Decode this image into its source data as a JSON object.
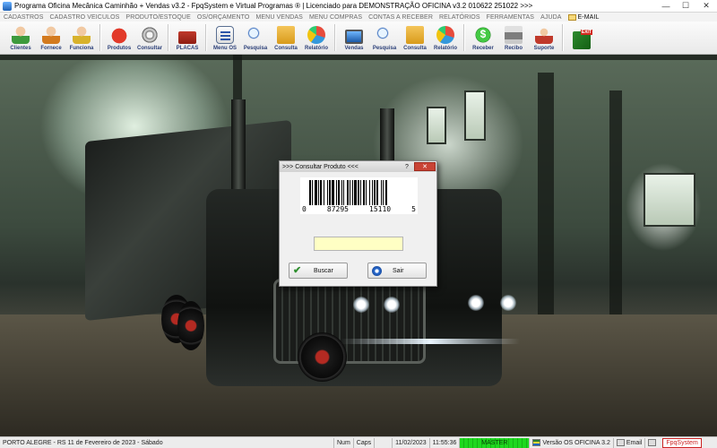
{
  "window": {
    "title": "Programa Oficina Mecânica Caminhão + Vendas v3.2 - FpqSystem e Virtual Programas ® | Licenciado para  DEMONSTRAÇÃO OFICINA v3.2 010622 251022 >>>",
    "minimize": "—",
    "maximize": "☐",
    "close": "✕"
  },
  "menu": [
    "CADASTROS",
    "CADASTRO VEICULOS",
    "PRODUTO/ESTOQUE",
    "OS/ORÇAMENTO",
    "MENU VENDAS",
    "MENU COMPRAS",
    "CONTAS A RECEBER",
    "RELATÓRIOS",
    "FERRAMENTAS",
    "AJUDA"
  ],
  "menu_email": "E-MAIL",
  "toolbar": [
    {
      "label": "Clientes",
      "icon": "clients-icon"
    },
    {
      "label": "Fornece",
      "icon": "supplier-icon"
    },
    {
      "label": "Funciona",
      "icon": "employee-icon"
    },
    {
      "label": "Produtos",
      "icon": "products-icon"
    },
    {
      "label": "Consultar",
      "icon": "disc-icon"
    },
    {
      "label": "PLACAS",
      "icon": "truck-icon"
    },
    {
      "label": "Menu OS",
      "icon": "clipboard-icon"
    },
    {
      "label": "Pesquisa",
      "icon": "search-icon"
    },
    {
      "label": "Consulta",
      "icon": "folder-icon"
    },
    {
      "label": "Relatório",
      "icon": "chart-icon"
    },
    {
      "label": "Vendas",
      "icon": "screen-icon"
    },
    {
      "label": "Pesquisa",
      "icon": "search-icon"
    },
    {
      "label": "Consulta",
      "icon": "folder-icon"
    },
    {
      "label": "Relatório",
      "icon": "chart-icon"
    },
    {
      "label": "Receber",
      "icon": "money-icon"
    },
    {
      "label": "Recibo",
      "icon": "printer-icon"
    },
    {
      "label": "Suporte",
      "icon": "support-icon"
    },
    {
      "label": "",
      "icon": "exit-icon"
    }
  ],
  "dialog": {
    "title": ">>> Consultar Produto <<<",
    "help": "?",
    "close": "✕",
    "barcode_digits": [
      "0",
      "87295",
      "15110",
      "5"
    ],
    "code_value": "",
    "buscar_label": "Buscar",
    "sair_label": "Sair"
  },
  "status": {
    "location": "PORTO ALEGRE - RS 11 de Fevereiro de 2023 - Sábado",
    "num": "Num",
    "caps": "Caps",
    "blank": "",
    "date": "11/02/2023",
    "time": "11:55:36",
    "master": "MASTER",
    "version": "Versão OS OFICINA 3.2",
    "email": "Email",
    "brand": "FpqSystem"
  }
}
